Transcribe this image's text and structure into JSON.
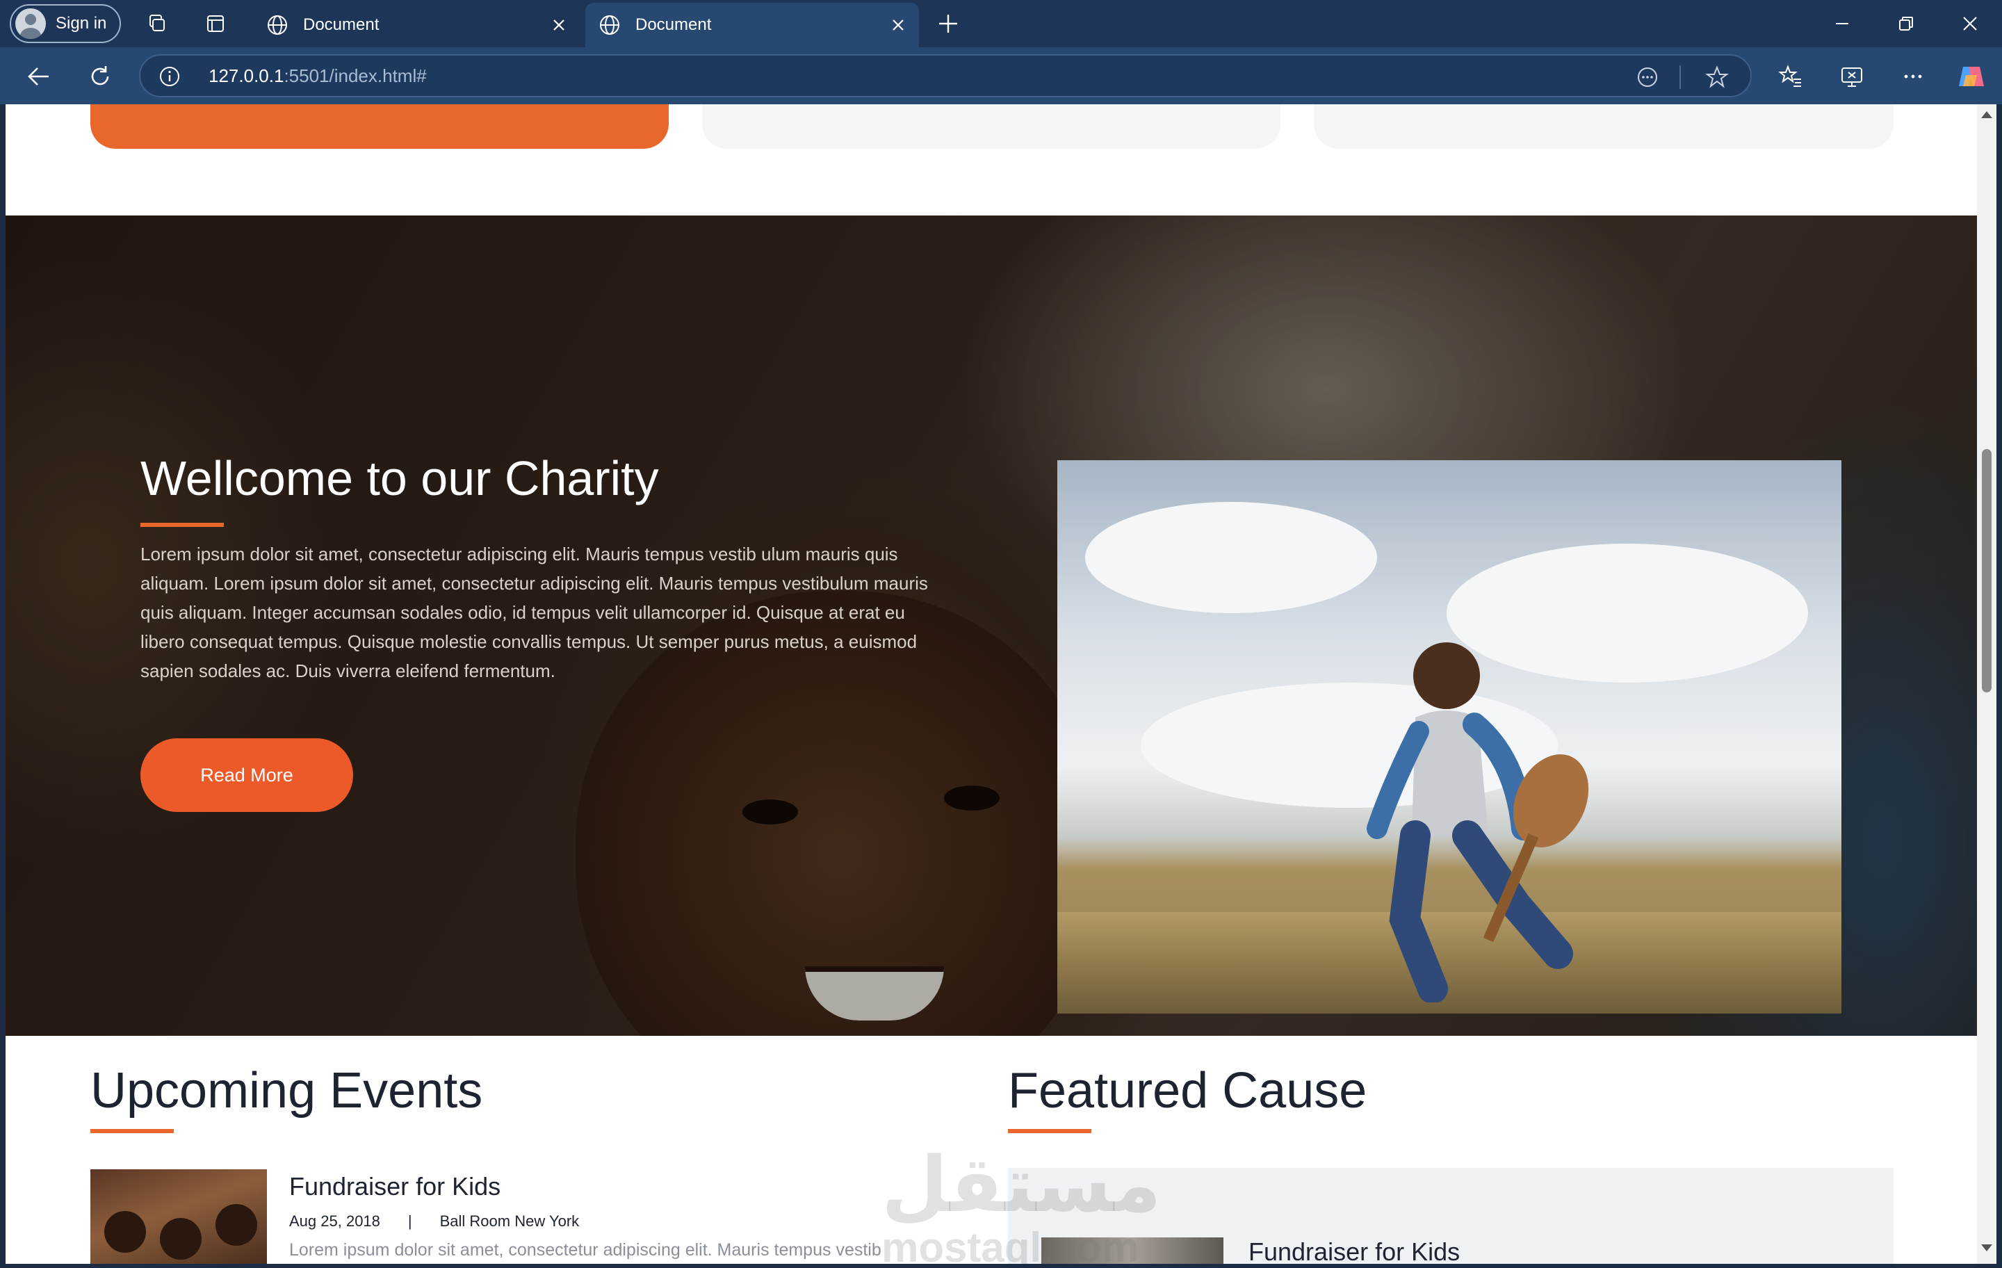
{
  "browser": {
    "signin_label": "Sign in",
    "tabs": [
      {
        "title": "Document"
      },
      {
        "title": "Document"
      }
    ],
    "url_host": "127.0.0.1",
    "url_path": ":5501/index.html#"
  },
  "hero": {
    "title": "Wellcome to our Charity",
    "body": "Lorem ipsum dolor sit amet, consectetur adipiscing elit. Mauris tempus vestib ulum mauris quis aliquam. Lorem ipsum dolor sit amet, consectetur adipiscing elit. Mauris tempus vestibulum mauris quis aliquam. Integer accumsan sodales odio, id tempus velit ullamcorper id. Quisque at erat eu libero consequat tempus. Quisque molestie convallis tempus. Ut semper purus metus, a euismod sapien sodales ac. Duis viverra eleifend fermentum.",
    "button": "Read More"
  },
  "events": {
    "heading": "Upcoming Events",
    "items": [
      {
        "title": "Fundraiser for Kids",
        "date": "Aug 25, 2018",
        "separator": "|",
        "location": "Ball Room New York",
        "desc": "Lorem ipsum dolor sit amet, consectetur adipiscing elit. Mauris tempus vestib"
      }
    ]
  },
  "featured": {
    "heading": "Featured Cause",
    "items": [
      {
        "title": "Fundraiser for Kids"
      }
    ]
  },
  "watermark": {
    "arabic": "مستقل",
    "latin": "mostaql.com"
  },
  "colors": {
    "accent": "#e8672a",
    "tab_bar": "#1d3557",
    "address_bar": "#274870"
  }
}
